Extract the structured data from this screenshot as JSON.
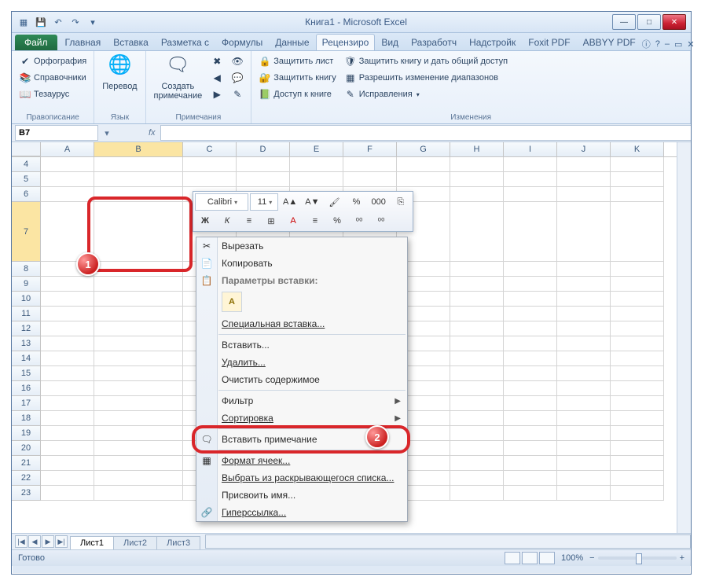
{
  "title": "Книга1  -  Microsoft Excel",
  "qat": {
    "save": "💾",
    "undo": "↶",
    "redo": "↷",
    "more": "▾"
  },
  "tabs": {
    "file": "Файл",
    "list": [
      "Главная",
      "Вставка",
      "Разметка с",
      "Формулы",
      "Данные",
      "Рецензиро",
      "Вид",
      "Разработч",
      "Надстройк",
      "Foxit PDF",
      "ABBYY PDF"
    ],
    "activeIndex": 5
  },
  "ribbon": {
    "group1": {
      "label": "Правописание",
      "orfografiya": "Орфография",
      "spravochniki": "Справочники",
      "tezaurus": "Тезаурус"
    },
    "group2": {
      "label": "Язык",
      "perevod": "Перевод"
    },
    "group3": {
      "label": "Примечания",
      "sozdat": "Создать\nпримечание"
    },
    "group4": {
      "label": "Изменения",
      "protect_sheet": "Защитить лист",
      "protect_book": "Защитить книгу",
      "access_book": "Доступ к книге",
      "share_protect": "Защитить книгу и дать общий доступ",
      "allow_ranges": "Разрешить изменение диапазонов",
      "fixes": "Исправления"
    }
  },
  "namebox": "B7",
  "fx": "fx",
  "columns": [
    "A",
    "B",
    "C",
    "D",
    "E",
    "F",
    "G",
    "H",
    "I",
    "J",
    "K"
  ],
  "colWidthsWide": 1,
  "rows": [
    "4",
    "5",
    "6",
    "7",
    "8",
    "9",
    "10",
    "11",
    "12",
    "13",
    "14",
    "15",
    "16",
    "17",
    "18",
    "19",
    "20",
    "21",
    "22",
    "23"
  ],
  "selRow": "7",
  "selCol": "B",
  "minitb": {
    "font": "Calibri",
    "size": "11",
    "row1": [
      "A▲",
      "A▼",
      "🖌",
      "%",
      "000",
      "⎘"
    ],
    "row2": [
      "Ж",
      "К",
      "≡",
      "⊞",
      "A",
      "≡",
      "%",
      "⁰⁰",
      "⁰⁰"
    ]
  },
  "ctx": {
    "cut": "Вырезать",
    "copy": "Копировать",
    "paste_head": "Параметры вставки:",
    "paste_opt": "A",
    "paste_special": "Специальная вставка...",
    "insert": "Вставить...",
    "delete": "Удалить...",
    "clear": "Очистить содержимое",
    "filter": "Фильтр",
    "sort": "Сортировка",
    "insert_comment": "Вставить примечание",
    "format_cells": "Формат ячеек...",
    "dropdown": "Выбрать из раскрывающегося списка...",
    "name": "Присвоить имя...",
    "hyperlink": "Гиперссылка..."
  },
  "sheets": {
    "nav": [
      "|◀",
      "◀",
      "▶",
      "▶|"
    ],
    "list": [
      "Лист1",
      "Лист2",
      "Лист3"
    ],
    "active": 0
  },
  "status": {
    "ready": "Готово",
    "zoom": "100%"
  },
  "badges": {
    "b1": "1",
    "b2": "2"
  },
  "winbtns": {
    "min": "—",
    "max": "□",
    "close": "✕"
  },
  "helpicons": {
    "help": "?",
    "min": "▭",
    "close": "✕"
  }
}
